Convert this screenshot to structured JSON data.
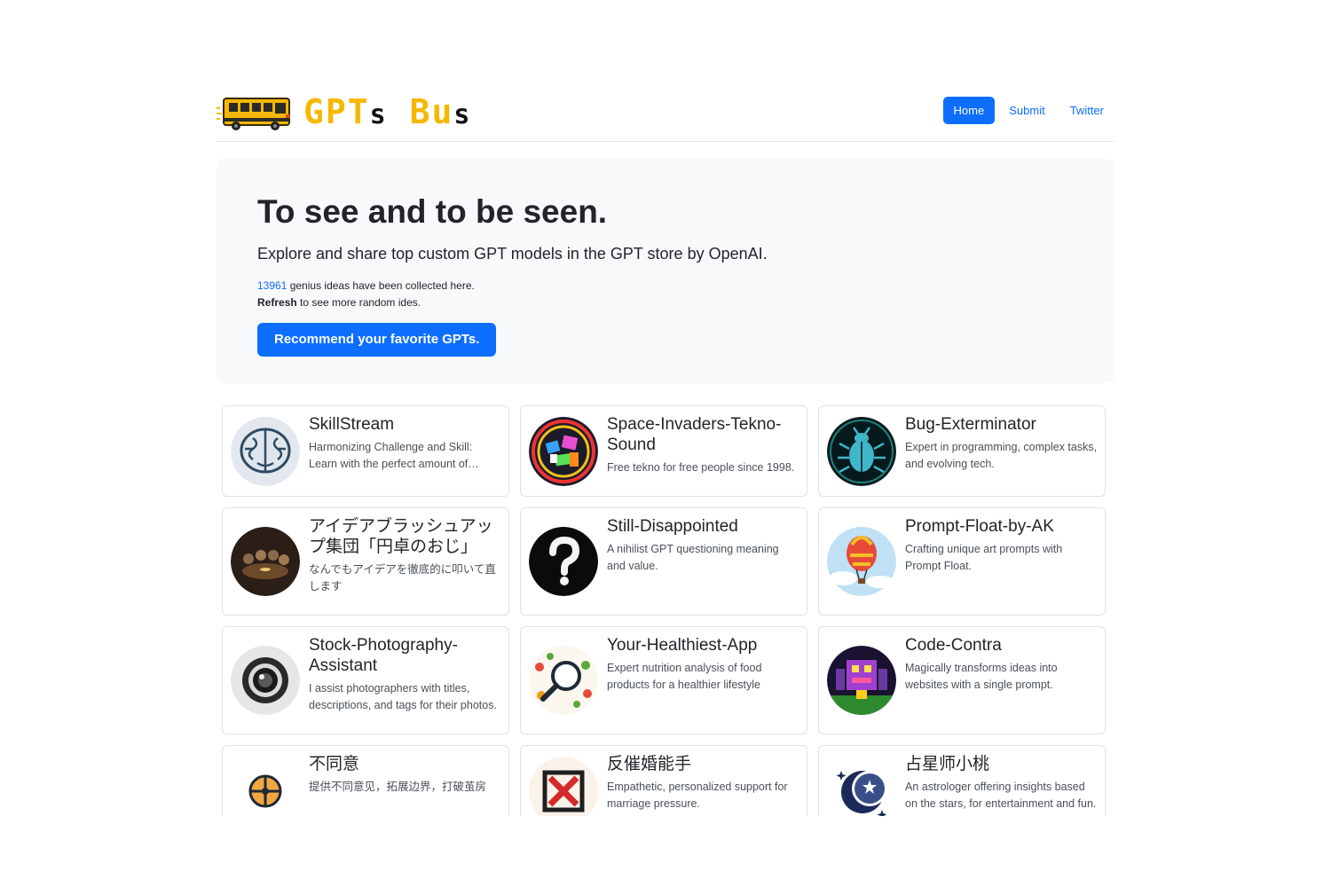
{
  "brand": {
    "name_part1": "GPT",
    "name_part2": "s",
    "name_part3": "Bu",
    "name_part4": "s",
    "logo_icon": "school-bus-icon"
  },
  "nav": [
    {
      "label": "Home",
      "active": true
    },
    {
      "label": "Submit",
      "active": false
    },
    {
      "label": "Twitter",
      "active": false
    }
  ],
  "hero": {
    "title": "To see and to be seen.",
    "lead": "Explore and share top custom GPT models in the GPT store by OpenAI.",
    "count": "13961",
    "count_suffix": " genius ideas have been collected here.",
    "refresh_bold": "Refresh",
    "refresh_suffix": " to see more random ides.",
    "cta_label": "Recommend your favorite GPTs."
  },
  "cards": [
    {
      "title": "SkillStream",
      "desc": "Harmonizing Challenge and Skill: Learn with the perfect amount of challenge.",
      "icon": "brain-icon"
    },
    {
      "title": "Space-Invaders-Tekno-Sound",
      "desc": "Free tekno for free people since 1998.",
      "icon": "colorful-collage-icon"
    },
    {
      "title": "Bug-Exterminator",
      "desc": "Expert in programming, complex tasks, and evolving tech.",
      "icon": "beetle-icon"
    },
    {
      "title": "アイデアブラッシュアップ集団「円卓のおじ」",
      "desc": "なんでもアイデアを徹底的に叩いて直します",
      "icon": "round-table-icon"
    },
    {
      "title": "Still-Disappointed",
      "desc": "A nihilist GPT questioning meaning and value.",
      "icon": "question-mark-icon"
    },
    {
      "title": "Prompt-Float-by-AK",
      "desc": "Crafting unique art prompts with Prompt Float.",
      "icon": "hot-air-balloon-icon"
    },
    {
      "title": "Stock-Photography-Assistant",
      "desc": "I assist photographers with titles, descriptions, and tags for their photos.",
      "icon": "camera-lens-icon"
    },
    {
      "title": "Your-Healthiest-App",
      "desc": "Expert nutrition analysis of food products for a healthier lifestyle",
      "icon": "magnifier-food-icon"
    },
    {
      "title": "Code-Contra",
      "desc": "Magically transforms ideas into websites with a single prompt.",
      "icon": "pixel-robot-icon"
    },
    {
      "title": "不同意",
      "desc": "提供不同意见，拓展边界，打破茧房",
      "icon": "crosshair-circle-icon"
    },
    {
      "title": "反催婚能手",
      "desc": "Empathetic, personalized support for marriage pressure.",
      "icon": "x-box-icon"
    },
    {
      "title": "占星师小桃",
      "desc": "An astrologer offering insights based on the stars, for entertainment and fun.",
      "icon": "crescent-moon-icon"
    }
  ],
  "colors": {
    "primary": "#0d6efd",
    "brand_yellow": "#f5b800",
    "hero_bg": "#f8f9fa",
    "border": "#dee2e6"
  }
}
